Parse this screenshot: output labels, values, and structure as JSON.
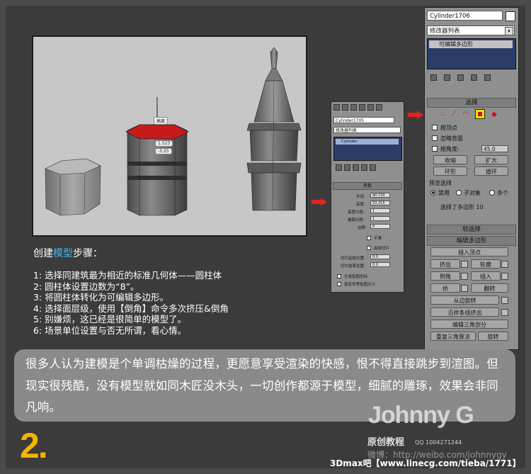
{
  "viewport": {
    "tooltip_top": "高度",
    "tooltip_mid": "1.523",
    "tooltip_low": "-3.25"
  },
  "steps": {
    "title_prefix": "创建",
    "title_highlight": "模型",
    "title_suffix": "步骤：",
    "items": [
      "1: 选择同建筑最为相近的标准几何体——圆柱体",
      "2: 圆柱体设置边数为“8”。",
      "3: 将圆柱体转化为可编辑多边形。",
      "4: 选择面层级，使用【倒角】命令多次挤压&倒角",
      "5: 别嫌烦，这已经是很简单的模型了。",
      "6: 场景单位设置与否无所谓，看心情。"
    ]
  },
  "banner": {
    "text": "很多人认为建模是个单调枯燥的过程，更愿意享受渲染的快感，恨不得直接跳步到渲图。但现实很残酷，没有模型就如同木匠没木头，一切创作都源于模型，细腻的雕琢，效果会非同凡响。"
  },
  "branding": {
    "step_number": "2.",
    "logo": "Johnny G",
    "subtitle": "原创教程",
    "qq": "QQ 1004271244",
    "weibo": "微博：http://weibo.com/johnnygy",
    "footer": "3Dmax吧【www.linecg.com/tieba/1771】"
  },
  "small_panel": {
    "object_name": "Cylinder1705",
    "modifier_list": "修改器列表",
    "stack_item": "Cylinder",
    "params_header": "参数",
    "radius_label": "半径:",
    "radius_value": "40.739",
    "height_label": "高度:",
    "height_value": "53.215",
    "height_segs_label": "高度分段:",
    "height_segs_value": "1",
    "cap_segs_label": "端面分段:",
    "cap_segs_value": "1",
    "sides_label": "边数:",
    "sides_value": "8",
    "smooth_label": "平滑",
    "slice_label": "启用切片",
    "slice_from_label": "切片起始位置:",
    "slice_from_value": "0.0",
    "slice_to_label": "切片结束位置:",
    "slice_to_value": "0.0",
    "gen_map_label": "生成贴图坐标",
    "real_world_label": "真实世界贴图大小"
  },
  "big_panel": {
    "object_name": "Cylinder1706",
    "modifier_list": "修改器列表",
    "stack_item": "可编辑多边形",
    "select_header": "选择",
    "by_vertex": "按顶点",
    "ignore_back": "忽略背面",
    "by_angle": "按角度:",
    "angle_value": "45.0",
    "shrink": "收缩",
    "grow": "扩大",
    "ring": "环形",
    "loop": "循环",
    "preview_header": "预览选择",
    "disabled": "禁用",
    "sub_object": "子对象",
    "multi": "多个",
    "selection_status": "选择了多边形 10",
    "soft_select": "软选择",
    "edit_polygons": "编辑多边形",
    "insert_vertex": "插入顶点",
    "extrude": "挤出",
    "outline": "轮廓",
    "bevel": "倒角",
    "inset": "插入",
    "bridge": "桥",
    "flip": "翻转",
    "hinge": "从边旋转",
    "extrude_spline": "沿样条线挤出",
    "edit_tri": "编辑三角剖分",
    "retriangulate": "重复三角算法",
    "turn": "旋转"
  },
  "colors": {
    "accent_blue": "#43b7e8",
    "step_yellow": "#f4b400",
    "arrow_red": "#e0241b",
    "select_red": "#c8101a"
  }
}
